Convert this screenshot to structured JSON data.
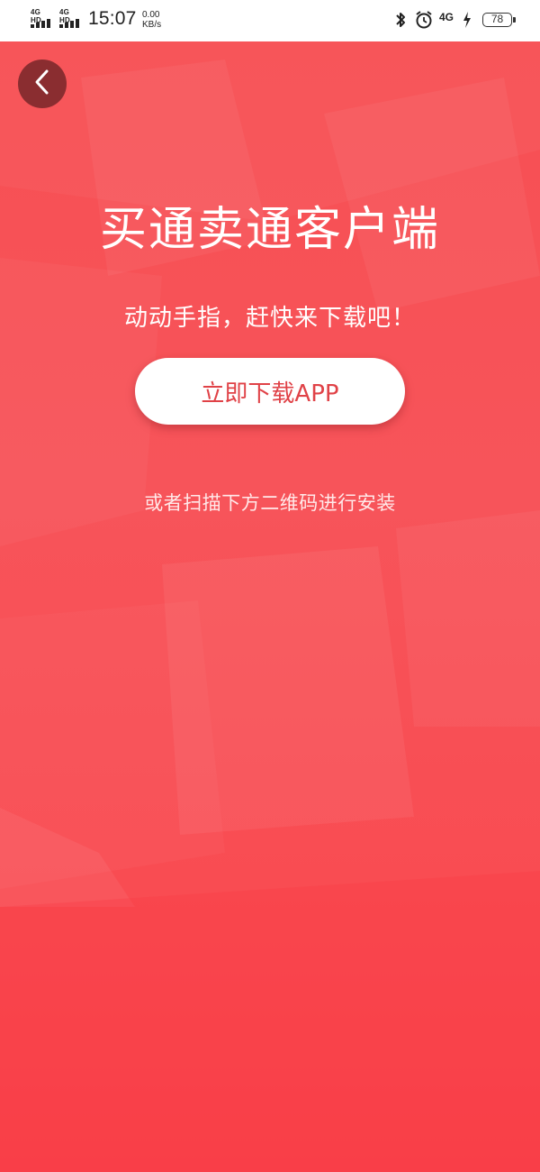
{
  "status_bar": {
    "sim1_label": "4G HD",
    "sim2_label": "4G HD",
    "time": "15:07",
    "net_speed_value": "0.00",
    "net_speed_unit": "KB/s",
    "network_type": "4G",
    "battery_level": "78",
    "icons": [
      "bluetooth-icon",
      "alarm-icon",
      "network-4g-icon",
      "charging-icon",
      "battery-icon"
    ]
  },
  "page": {
    "back_icon": "chevron-left-icon",
    "title": "买通卖通客户端",
    "subtitle": "动动手指，赶快来下载吧！",
    "download_button_label": "立即下载APP",
    "qr_hint": "或者扫描下方二维码进行安装"
  },
  "colors": {
    "background_top": "#f74f53",
    "background_bottom": "#f9404a",
    "button_bg": "#ffffff",
    "button_text": "#e04247",
    "back_button_bg": "#8a2d30"
  }
}
